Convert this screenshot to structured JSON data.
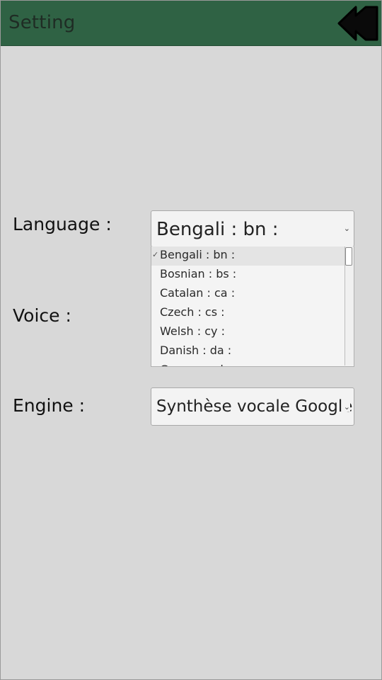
{
  "header": {
    "title": "Setting",
    "back_icon": "back-arrow-icon",
    "background_color": "#2f6244"
  },
  "form": {
    "language": {
      "label": "Language :",
      "selected": "Bengali : bn :",
      "options": [
        "Bengali : bn :",
        "Bosnian : bs :",
        "Catalan : ca :",
        "Czech : cs :",
        "Welsh : cy :",
        "Danish : da :",
        "German : de :"
      ],
      "selected_index": 0
    },
    "voice": {
      "label": "Voice :"
    },
    "engine": {
      "label": "Engine :",
      "selected": "Synthèse vocale Google"
    }
  },
  "colors": {
    "page_background": "#d8d8d8",
    "control_background": "#f3f3f3"
  }
}
